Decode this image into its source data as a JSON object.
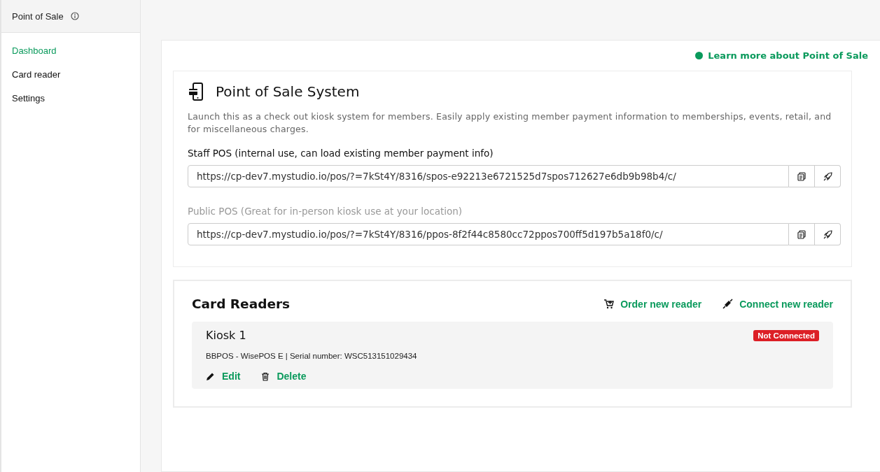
{
  "sidebar": {
    "title": "Point of Sale",
    "items": [
      {
        "label": "Dashboard",
        "selected": true
      },
      {
        "label": "Card reader",
        "selected": false
      },
      {
        "label": "Settings",
        "selected": false
      }
    ]
  },
  "learn_more": {
    "label": "Learn more about Point of Sale",
    "color": "#0a9a5c"
  },
  "pos_system": {
    "title": "Point of Sale System",
    "description": "Launch this as a check out kiosk system for members. Easily apply existing member payment information to memberships, events, retail, and for miscellaneous charges.",
    "links": [
      {
        "label": "Staff POS (internal use, can load existing member payment info)",
        "disabled": false,
        "value": "https://cp-dev7.mystudio.io/pos/?=7kSt4Y/8316/spos-e92213e6721525d7spos712627e6db9b98b4/c/"
      },
      {
        "label": "Public POS (Great for in-person kiosk use at your location)",
        "disabled": true,
        "value": "https://cp-dev7.mystudio.io/pos/?=7kSt4Y/8316/ppos-8f2f44c8580cc72ppos700ff5d197b5a18f0/c/"
      }
    ]
  },
  "card_readers": {
    "title": "Card Readers",
    "actions": [
      {
        "label": "Order new reader",
        "kind": "cart"
      },
      {
        "label": "Connect new reader",
        "kind": "plug"
      }
    ],
    "readers": [
      {
        "name": "Kiosk 1",
        "status": "Not Connected",
        "color": "#dc1f26",
        "details": "BBPOS - WisePOS E | Serial number: WSC513151029434",
        "actions": [
          {
            "label": "Edit",
            "kind": "edit"
          },
          {
            "label": "Delete",
            "kind": "delete"
          }
        ]
      }
    ]
  }
}
